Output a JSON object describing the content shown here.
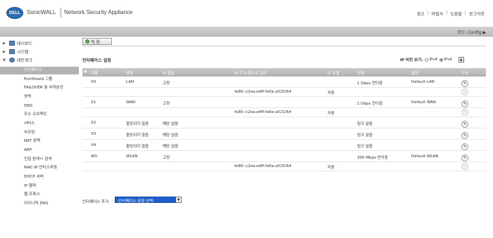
{
  "header": {
    "logo_text": "DELL",
    "brand": "SonicWALL",
    "product": "Network Security Appliance",
    "links": [
      "경고",
      "마법사",
      "도움말",
      "로그아웃"
    ]
  },
  "modebar": {
    "mode_text": "모드: Config ▶"
  },
  "sidebar": {
    "top_items": [
      {
        "label": "대시보드",
        "icon": "dashboard-icon",
        "expanded": false
      },
      {
        "label": "시스템",
        "icon": "system-icon",
        "expanded": false
      },
      {
        "label": "네트워크",
        "icon": "network-icon",
        "expanded": true
      }
    ],
    "selected": "인터페이스",
    "sub_items": [
      "PortShield 그룹",
      "FAILOVER 및 부하분산",
      "영역",
      "DNS",
      "주소 오브젝트",
      "서비스",
      "라우팅",
      "NAT 정책",
      "ARP",
      "인접 탐색ㅁ 검색",
      "MAC-IP 안티스푸핑",
      "DHCP 서버",
      "IP 헬퍼",
      "웹 프록시",
      "다이나믹 DNS"
    ]
  },
  "toolbar": {
    "apply_label": "적 용"
  },
  "section": {
    "title": "인터페이스 설정"
  },
  "ipver": {
    "label": "IP 버전 보기:",
    "opt1": "IPv4",
    "opt2": "IPv6",
    "selected": "IPv6"
  },
  "table": {
    "headers": [
      "이름",
      "영역",
      "IP 할당",
      "IP 주소/접두사 길이",
      "IP 유형",
      "상태",
      "설명",
      "구성"
    ],
    "rows": [
      {
        "name": "X0",
        "zone": "LAN",
        "assign": "고정",
        "ip": "",
        "type": "",
        "status": "1 Gbps 전이중",
        "desc": "Default LAN",
        "kind": "main"
      },
      {
        "name": "",
        "zone": "",
        "assign": "",
        "ip": "fe80::c2ea:e4ff:fe0e:a520/64",
        "type": "자동",
        "status": "",
        "desc": "",
        "kind": "sub"
      },
      {
        "name": "X1",
        "zone": "WAN",
        "assign": "고정",
        "ip": "",
        "type": "",
        "status": "1 Gbps 전이중",
        "desc": "Default WAN",
        "kind": "main"
      },
      {
        "name": "",
        "zone": "",
        "assign": "",
        "ip": "fe80::c2ea:e4ff:fe0e:a521/64",
        "type": "자동",
        "status": "",
        "desc": "",
        "kind": "sub"
      },
      {
        "name": "X2",
        "zone": "할당되지 않음",
        "assign": "해당 없음",
        "ip": "",
        "type": "",
        "status": "링크 없음",
        "desc": "",
        "kind": "main"
      },
      {
        "name": "X3",
        "zone": "할당되지 않음",
        "assign": "해당 없음",
        "ip": "",
        "type": "",
        "status": "링크 없음",
        "desc": "",
        "kind": "main"
      },
      {
        "name": "X4",
        "zone": "할당되지 않음",
        "assign": "해당 없음",
        "ip": "",
        "type": "",
        "status": "링크 없음",
        "desc": "",
        "kind": "main"
      },
      {
        "name": "W0",
        "zone": "WLAN",
        "assign": "고정",
        "ip": "",
        "type": "",
        "status": "300 Mbps 반이중",
        "desc": "Default WLAN",
        "kind": "main"
      },
      {
        "name": "",
        "zone": "",
        "assign": "",
        "ip": "fe80::c2ea:e4ff:fe0e:a525/64",
        "type": "자동",
        "status": "",
        "desc": "",
        "kind": "sub"
      }
    ]
  },
  "add_interface": {
    "label": "인터페이스 추가:",
    "selected": "-인터페이스 유형 선택-"
  }
}
